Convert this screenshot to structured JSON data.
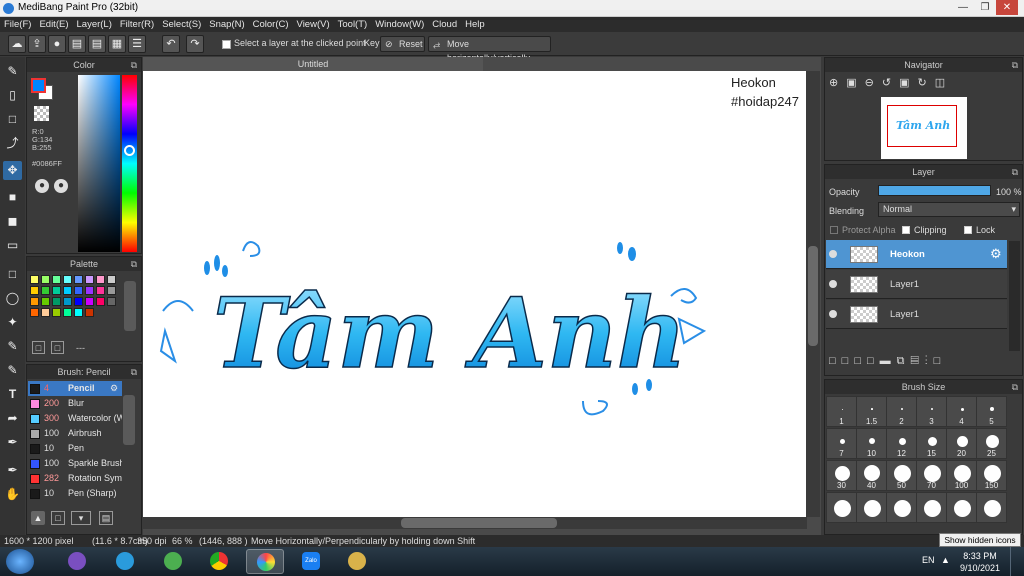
{
  "window": {
    "title": "MediBang Paint Pro (32bit)"
  },
  "menu": [
    "File(F)",
    "Edit(E)",
    "Layer(L)",
    "Filter(R)",
    "Select(S)",
    "Snap(N)",
    "Color(C)",
    "View(V)",
    "Tool(T)",
    "Window(W)",
    "Cloud",
    "Help"
  ],
  "toolbar": {
    "select_layer_label": "Select a layer at the clicked point",
    "key_label": "Key",
    "reset_label": "Reset",
    "move_label": "Move horizontally/vertically"
  },
  "color_panel": {
    "title": "Color",
    "r": "R:0",
    "g": "G:134",
    "b": "B:255",
    "hex": "#0086FF",
    "fg": "#0086ff",
    "bg": "#ffffff"
  },
  "palette": {
    "title": "Palette",
    "name": "---"
  },
  "brush_panel": {
    "title": "Brush: Pencil",
    "items": [
      {
        "size": "4",
        "name": "Pencil",
        "color": "#1a1a1a"
      },
      {
        "size": "200",
        "name": "Blur",
        "color": "#ff88dd"
      },
      {
        "size": "300",
        "name": "Watercolor (W",
        "color": "#55ccff"
      },
      {
        "size": "100",
        "name": "Airbrush",
        "color": "#aaaaaa"
      },
      {
        "size": "10",
        "name": "Pen",
        "color": "#1a1a1a"
      },
      {
        "size": "100",
        "name": "Sparkle Brush",
        "color": "#3355ff"
      },
      {
        "size": "282",
        "name": "Rotation Sym",
        "color": "#ff3333"
      },
      {
        "size": "10",
        "name": "Pen (Sharp)",
        "color": "#1a1a1a"
      }
    ]
  },
  "canvas": {
    "tab_title": "Untitled",
    "watermark_line1": "Heokon",
    "watermark_line2": "#hoidap247",
    "art_text": "Tâm Anh"
  },
  "navigator": {
    "title": "Navigator"
  },
  "layer_panel": {
    "title": "Layer",
    "opacity_label": "Opacity",
    "opacity_value": "100 %",
    "opacity_fraction": 1.0,
    "blending_label": "Blending",
    "blending_value": "Normal",
    "protect_alpha": "Protect Alpha",
    "clipping": "Clipping",
    "lock": "Lock",
    "layers": [
      {
        "name": "Heokon",
        "selected": true
      },
      {
        "name": "Layer1",
        "selected": false
      },
      {
        "name": "Layer1",
        "selected": false
      }
    ]
  },
  "brush_size": {
    "title": "Brush Size",
    "sizes": [
      "1",
      "1.5",
      "2",
      "3",
      "4",
      "5",
      "7",
      "10",
      "12",
      "15",
      "20",
      "25",
      "30",
      "40",
      "50",
      "70",
      "100",
      "150",
      "",
      "",
      "",
      "",
      "",
      ""
    ]
  },
  "status": {
    "dimensions": "1600 * 1200 pixel",
    "physical": "(11.6 * 8.7cm)",
    "dpi": "350 dpi",
    "zoom": "66 %",
    "coords": "(1446, 888 )",
    "hint": "Move Horizontally/Perpendicularly by holding down Shift"
  },
  "taskbar": {
    "lang": "EN",
    "time": "8:33 PM",
    "date": "9/10/2021",
    "tooltip": "Show hidden icons",
    "zalo": "Zalo"
  }
}
